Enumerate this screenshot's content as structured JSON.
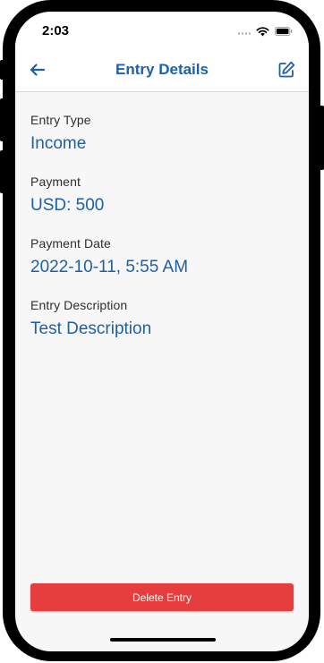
{
  "status_bar": {
    "time": "2:03"
  },
  "header": {
    "title": "Entry Details",
    "back_icon": "arrow-left-icon",
    "edit_icon": "edit-icon"
  },
  "fields": [
    {
      "label": "Entry Type",
      "value": "Income"
    },
    {
      "label": "Payment",
      "value": "USD: 500"
    },
    {
      "label": "Payment Date",
      "value": "2022-10-11, 5:55 AM"
    },
    {
      "label": "Entry Description",
      "value": "Test Description"
    }
  ],
  "actions": {
    "delete_label": "Delete Entry"
  },
  "colors": {
    "accent": "#1f5fa6",
    "danger": "#e63e3e",
    "background": "#f7f7f7"
  }
}
